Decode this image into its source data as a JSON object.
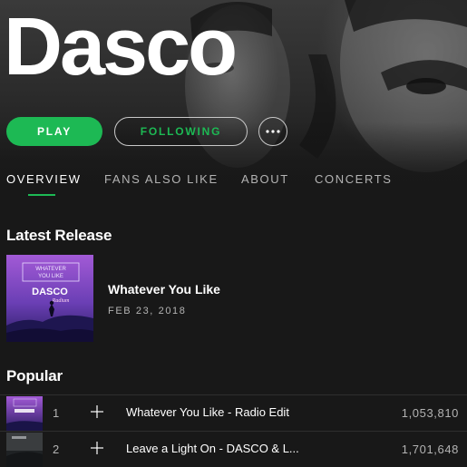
{
  "artist": {
    "name": "Dasco"
  },
  "actions": {
    "play_label": "PLAY",
    "following_label": "FOLLOWING",
    "more_icon": "more-dots-icon"
  },
  "tabs": [
    {
      "label": "OVERVIEW",
      "active": true
    },
    {
      "label": "FANS ALSO LIKE",
      "active": false
    },
    {
      "label": "ABOUT",
      "active": false
    },
    {
      "label": "CONCERTS",
      "active": false
    }
  ],
  "latest_release": {
    "section_title": "Latest Release",
    "title": "Whatever You Like",
    "date": "FEB 23, 2018",
    "cover": {
      "line1": "WHATEVER",
      "line2": "YOU LIKE",
      "artist": "DASCO",
      "feat": "Radium"
    }
  },
  "popular": {
    "section_title": "Popular",
    "tracks": [
      {
        "number": "1",
        "title": "Whatever You Like - Radio Edit",
        "plays": "1,053,810"
      },
      {
        "number": "2",
        "title": "Leave a Light On - DASCO & L...",
        "plays": "1,701,648"
      }
    ]
  },
  "colors": {
    "accent": "#1db954",
    "background": "#181818",
    "secondary_text": "#b3b3b3"
  }
}
